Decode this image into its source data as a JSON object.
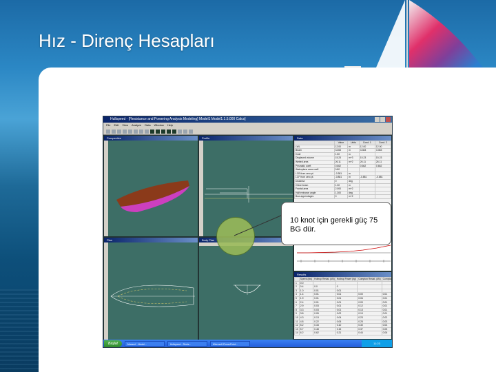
{
  "slide": {
    "title": "Hız - Direnç Hesapları",
    "callout_text": "10 knot için gerekli güç 75 BG dür."
  },
  "app": {
    "window_title": "Hullspeed - [Resistance and Powering Analysis Modeling] Model1 Model1.1.5.000 Calcs]",
    "menu": [
      "File",
      "Edit",
      "View",
      "Analyze",
      "Data",
      "Window",
      "Help"
    ],
    "panes": {
      "perspective": "Perspective",
      "profile": "Profile",
      "plan": "Plan",
      "body_plan": "Body Plan",
      "data": "Data",
      "results": "Results"
    },
    "data_table": {
      "headers": [
        "",
        "Value",
        "Units",
        "Cond. 1",
        "Cond. 2"
      ],
      "rows": [
        [
          "LWL",
          "12.00",
          "m",
          "12.00",
          "12.00"
        ],
        [
          "Beam",
          "3.353",
          "m",
          "3.353",
          "3.353"
        ],
        [
          "Draft",
          "1.50",
          "m",
          "",
          ""
        ],
        [
          "Displaced volume",
          "15.23",
          "m^3",
          "15.23",
          "15.23"
        ],
        [
          "Wetted area",
          "26.11",
          "m^2",
          "26.11",
          "26.11"
        ],
        [
          "Prismatic coeff.",
          "0.662",
          "",
          "0.662",
          "0.662"
        ],
        [
          "Waterplane area coeff.",
          "0.80",
          "",
          "",
          ""
        ],
        [
          "LCB from zero pt.",
          "-0.381",
          "m",
          "",
          ""
        ],
        [
          "LCF from zero pt.",
          "-0.881",
          "m",
          "-0.881",
          "-0.881"
        ],
        [
          "Deadrise",
          "0",
          "deg",
          "",
          ""
        ],
        [
          "Chine beam",
          "1.30",
          "m",
          "",
          ""
        ],
        [
          "Frontal area",
          "2.000",
          "m^2",
          "",
          ""
        ],
        [
          "Half entrance angle",
          "1.300",
          "deg",
          "",
          ""
        ],
        [
          "Bow appendages",
          "0",
          "m^2",
          "",
          ""
        ]
      ]
    },
    "results_table": {
      "headers": [
        "",
        "Speed (kts)",
        "Holtrop Resist. (kN)",
        "Holtrop Power (hp)",
        "Compton Resist. (kN)",
        "Compton Power (hp)"
      ],
      "rows": [
        [
          "1",
          "0.0",
          "",
          "",
          "",
          ""
        ],
        [
          "2",
          "0.4",
          "0.0",
          "0",
          "",
          ""
        ],
        [
          "3",
          "1.0",
          "0.01",
          "0.01",
          "",
          ""
        ],
        [
          "4",
          "1.4",
          "0.01",
          "0.01",
          "0.00",
          "0.01"
        ],
        [
          "5",
          "1.9",
          "0.01",
          "0.01",
          "0.06",
          "0.01"
        ],
        [
          "6",
          "2.4",
          "0.01",
          "0.01",
          "0.09",
          "0.01"
        ],
        [
          "7",
          "2.9",
          "0.03",
          "0.01",
          "0.12",
          "0.01"
        ],
        [
          "8",
          "3.3",
          "0.03",
          "0.01",
          "0.13",
          "0.01"
        ],
        [
          "9",
          "3.8",
          "0.05",
          "0.02",
          "0.19",
          "0.01"
        ],
        [
          "10",
          "4.3",
          "0.13",
          "0.04",
          "0.23",
          "0.02"
        ],
        [
          "11",
          "4.8",
          "0.22",
          "0.06",
          "0.25",
          "0.03"
        ],
        [
          "12",
          "5.2",
          "0.33",
          "0.10",
          "0.30",
          "0.04"
        ],
        [
          "13",
          "5.7",
          "0.48",
          "0.15",
          "0.37",
          "0.05"
        ],
        [
          "14",
          "6.2",
          "0.62",
          "0.21",
          "0.44",
          "0.06"
        ]
      ]
    },
    "status_text": "Hull Calcs (Holtrop): Marked: 1 lines",
    "taskbar": {
      "start_label": "Başlat",
      "tasks": [
        "Maxsurf - Model...",
        "Hullspeed - Resis...",
        "Microsoft PowerPoint..."
      ],
      "clock": "11:23"
    }
  },
  "colors": {
    "hull_top": "#8b3a1a",
    "hull_side": "#cc3fbf",
    "pane_bg": "#3d6e66",
    "callout_circle": "#9bbb59",
    "resistance_curve": "#cc0000"
  }
}
